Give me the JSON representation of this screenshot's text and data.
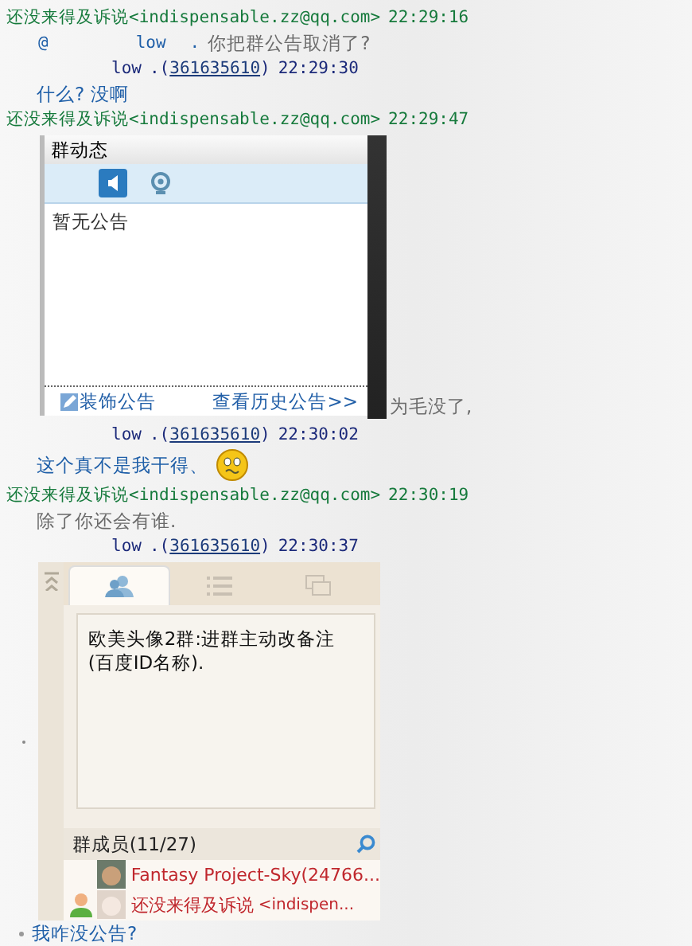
{
  "messages": [
    {
      "kind": "sender-email",
      "name": "还没来得及诉说",
      "address": "<indispensable.zz@qq.com>",
      "time": "22:29:16"
    },
    {
      "kind": "mention",
      "at": "@",
      "name": "low",
      "dot": ".",
      "text": "你把群公告取消了?"
    },
    {
      "kind": "sender-qq",
      "name": "low",
      "prefix": ".(",
      "qq": "361635610",
      "suffix": ")",
      "time": "22:29:30"
    },
    {
      "kind": "reply",
      "text": "什么? 没啊"
    },
    {
      "kind": "sender-email",
      "name": "还没来得及诉说",
      "address": "<indispensable.zz@qq.com>",
      "time": "22:29:47"
    },
    {
      "kind": "announcement-shot",
      "title": "群动态",
      "tabs": [
        {
          "selected": true
        },
        {
          "selected": false
        }
      ],
      "body": "暂无公告",
      "decorate": "装饰公告",
      "history": "查看历史公告>>",
      "caption": "为毛没了,"
    },
    {
      "kind": "sender-qq",
      "name": "low",
      "prefix": ".(",
      "qq": "361635610",
      "suffix": ")",
      "time": "22:30:02"
    },
    {
      "kind": "reply",
      "text": "这个真不是我干得、",
      "emoji": true
    },
    {
      "kind": "sender-email",
      "name": "还没来得及诉说",
      "address": "<indispensable.zz@qq.com>",
      "time": "22:30:19"
    },
    {
      "kind": "remark",
      "text": "除了你还会有谁."
    },
    {
      "kind": "sender-qq",
      "name": "low",
      "prefix": ".(",
      "qq": "361635610",
      "suffix": ")",
      "time": "22:30:37"
    },
    {
      "kind": "group-shot",
      "tabs": [
        {
          "selected": true
        },
        {
          "selected": false
        },
        {
          "selected": false
        }
      ],
      "notice": "欧美头像2群:进群主动改备注(百度ID名称).",
      "members_label": "群成员",
      "members_count": "(11/27)",
      "members": [
        {
          "name": "Fantasy Project-Sky(24766...",
          "role_icon": false
        },
        {
          "name": "还没来得及诉说",
          "suffix": "<indispen...",
          "role_icon": true
        }
      ]
    },
    {
      "kind": "reply",
      "text": "我咋没公告?",
      "bullet": true
    }
  ]
}
